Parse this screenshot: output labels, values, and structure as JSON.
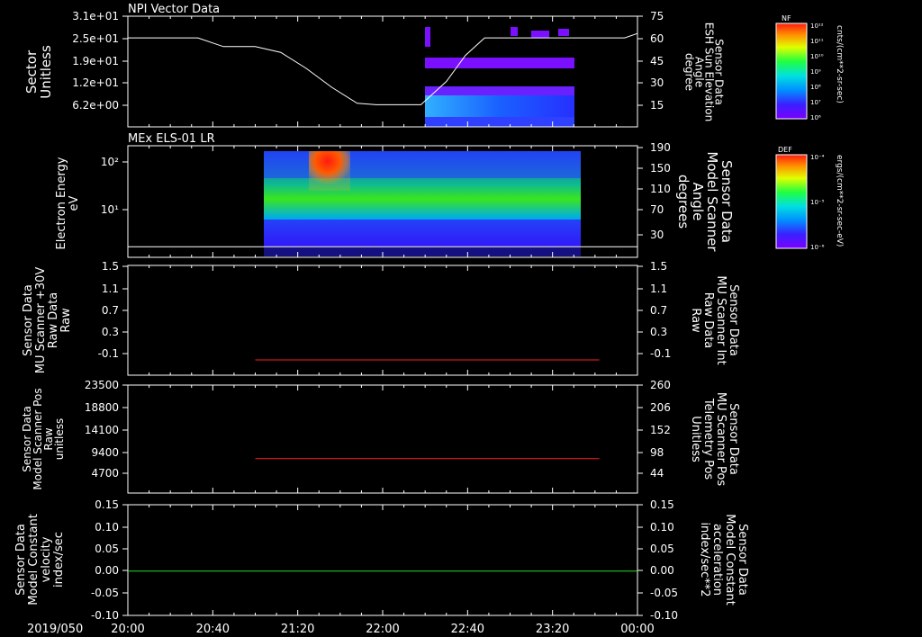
{
  "figure": {
    "date_label": "2019/050",
    "time_ticks": [
      "20:00",
      "20:40",
      "21:20",
      "22:00",
      "22:40",
      "23:20",
      "00:00"
    ]
  },
  "panels": {
    "p1": {
      "title": "NPI Vector Data",
      "ylabel": [
        "Sector",
        "Unitless"
      ],
      "left_ticks": [
        "3.1e+01",
        "2.5e+01",
        "1.9e+01",
        "1.2e+01",
        "6.2e+00"
      ],
      "right_ticks": [
        "75",
        "60",
        "45",
        "30",
        "15"
      ],
      "right_label": [
        "Sensor Data",
        "ESH Sun Elevation",
        "Angle",
        "degree"
      ],
      "colorbar": {
        "title": "NF",
        "unit": "cnts/(cm**2-sr-sec)",
        "ticks": [
          "10¹²",
          "10¹¹",
          "10¹⁰",
          "10⁹",
          "10⁸",
          "10⁷",
          "10⁶"
        ]
      }
    },
    "p2": {
      "title": "MEx ELS-01 LR",
      "ylabel": [
        "Electron Energy",
        "eV"
      ],
      "left_ticks": [
        "10²",
        "10¹"
      ],
      "right_ticks": [
        "190",
        "150",
        "110",
        "70",
        "30"
      ],
      "right_label": [
        "Sensor Data",
        "Model Scanner",
        "Angle",
        "degrees"
      ],
      "colorbar": {
        "title": "DEF",
        "unit": "ergs/(cm**2-sr-sec-eV)",
        "ticks": [
          "10⁻⁴",
          "10⁻⁵",
          "10⁻⁶"
        ]
      }
    },
    "p3": {
      "ylabel": [
        "Sensor Data",
        "MU Scanner +30V",
        "Raw Data",
        "Raw"
      ],
      "left_ticks": [
        "1.5",
        "1.1",
        "0.7",
        "0.3",
        "-0.1"
      ],
      "right_ticks": [
        "1.5",
        "1.1",
        "0.7",
        "0.3",
        "-0.1"
      ],
      "right_label": [
        "Sensor Data",
        "MU Scanner Int",
        "Raw Data",
        "Raw"
      ]
    },
    "p4": {
      "ylabel": [
        "Sensor Data",
        "Model Scanner Pos",
        "Raw",
        "unitless"
      ],
      "left_ticks": [
        "23500",
        "18800",
        "14100",
        "9400",
        "4700"
      ],
      "right_ticks": [
        "260",
        "206",
        "152",
        "98",
        "44"
      ],
      "right_label": [
        "Sensor Data",
        "MU Scanner Pos",
        "Telemetry Pos",
        "Unitless"
      ]
    },
    "p5": {
      "ylabel": [
        "Sensor Data",
        "Model Constant",
        "velocity",
        "index/sec"
      ],
      "left_ticks": [
        "0.15",
        "0.10",
        "0.05",
        "0.00",
        "-0.05",
        "-0.10"
      ],
      "right_ticks": [
        "0.15",
        "0.10",
        "0.05",
        "0.00",
        "-0.05",
        "-0.10"
      ],
      "right_label": [
        "Sensor Data",
        "Model Constant",
        "acceleration",
        "index/sec**2"
      ]
    }
  },
  "colors": {
    "white": "#ffffff",
    "red": "#ff2020",
    "green": "#22dd22",
    "axis": "#ffffff"
  },
  "chart_data": [
    {
      "type": "line",
      "panel": "NPI Vector Data",
      "series_label": "ESH Sun Elevation Angle (degree)",
      "x_unit": "hours since 2019/050 00:00",
      "xlim": [
        20.0,
        24.0
      ],
      "ylim_right": [
        0,
        75
      ],
      "x": [
        20.0,
        20.55,
        20.75,
        21.0,
        21.2,
        21.4,
        21.6,
        21.8,
        21.95,
        22.1,
        22.3,
        22.5,
        22.65,
        22.8,
        23.0,
        23.4,
        23.7,
        23.9,
        24.0
      ],
      "y": [
        60,
        60,
        54,
        54,
        50,
        39,
        26,
        15,
        14,
        14,
        14,
        30,
        48,
        60,
        60,
        60,
        60,
        60,
        63
      ]
    },
    {
      "type": "heatmap",
      "panel": "NPI Vector Data",
      "description_free": true,
      "xlim": [
        22.3,
        23.55
      ],
      "sector_bands": [
        [
          6.2,
          12.2
        ],
        [
          18,
          20
        ],
        [
          24,
          26
        ]
      ]
    },
    {
      "type": "heatmap",
      "panel": "MEx ELS-01 LR",
      "xlim": [
        21.05,
        23.55
      ],
      "energy_range_eV": [
        1.5,
        180
      ],
      "angle_line_right": [
        0,
        190
      ],
      "angle_value": 18
    },
    {
      "type": "line",
      "panel": "MU Scanner Raw",
      "xlim": [
        20.0,
        24.0
      ],
      "ylim": [
        -0.3,
        1.5
      ],
      "x": [
        21.0,
        23.7
      ],
      "y": [
        -0.05,
        -0.05
      ]
    },
    {
      "type": "line",
      "panel": "Model Scanner Pos",
      "xlim": [
        20.0,
        24.0
      ],
      "ylim": [
        0,
        23500
      ],
      "x": [
        21.0,
        23.7
      ],
      "y": [
        7500,
        7500
      ]
    },
    {
      "type": "line",
      "panel": "Model Constant velocity",
      "xlim": [
        20.0,
        24.0
      ],
      "ylim": [
        -0.1,
        0.15
      ],
      "x": [
        20.0,
        24.0
      ],
      "y": [
        0.0,
        0.0
      ]
    }
  ]
}
